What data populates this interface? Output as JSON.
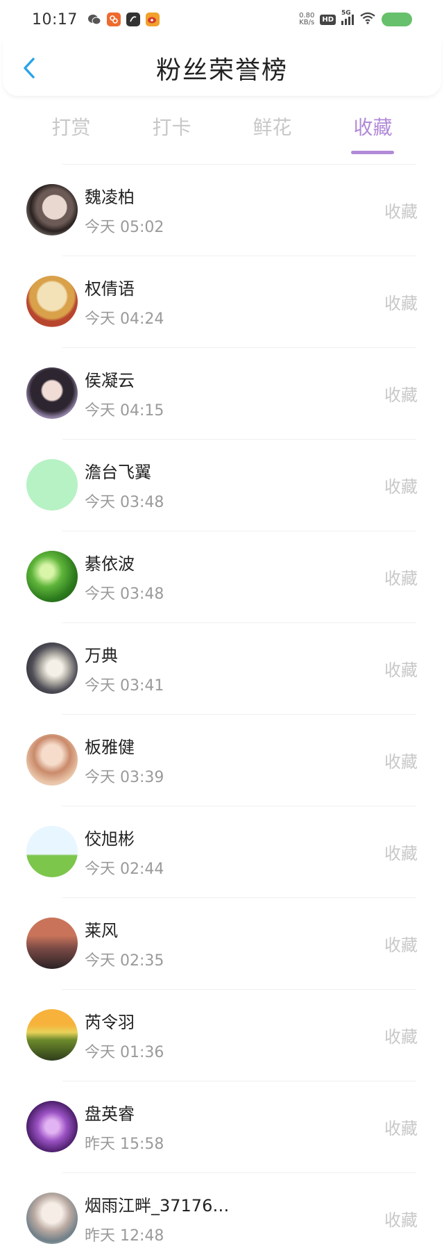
{
  "status_bar": {
    "time": "10:17",
    "net_speed_value": "0.80",
    "net_speed_unit": "KB/s",
    "hd_label": "HD",
    "network_label": "5G",
    "app_icons": [
      "wechat-icon",
      "app-icon-orange",
      "app-icon-dark",
      "weibo-icon"
    ]
  },
  "header": {
    "title": "粉丝荣誉榜",
    "back_icon": "chevron-left-icon"
  },
  "tabs": [
    {
      "label": "打赏",
      "active": false
    },
    {
      "label": "打卡",
      "active": false
    },
    {
      "label": "鲜花",
      "active": false
    },
    {
      "label": "收藏",
      "active": true
    }
  ],
  "colors": {
    "accent": "#b28ad7",
    "back_icon": "#2aa5e6",
    "battery": "#67c06b"
  },
  "fans": [
    {
      "name": "魏凌柏",
      "time": "今天 05:02",
      "action": "收藏"
    },
    {
      "name": "权倩语",
      "time": "今天 04:24",
      "action": "收藏"
    },
    {
      "name": "侯凝云",
      "time": "今天 04:15",
      "action": "收藏"
    },
    {
      "name": "澹台飞翼",
      "time": "今天 03:48",
      "action": "收藏"
    },
    {
      "name": "綦依波",
      "time": "今天 03:48",
      "action": "收藏"
    },
    {
      "name": "万典",
      "time": "今天 03:41",
      "action": "收藏"
    },
    {
      "name": "板雅健",
      "time": "今天 03:39",
      "action": "收藏"
    },
    {
      "name": "佼旭彬",
      "time": "今天 02:44",
      "action": "收藏"
    },
    {
      "name": "莱风",
      "time": "今天 02:35",
      "action": "收藏"
    },
    {
      "name": "芮令羽",
      "time": "今天 01:36",
      "action": "收藏"
    },
    {
      "name": "盘英睿",
      "time": "昨天 15:58",
      "action": "收藏"
    },
    {
      "name": "烟雨江畔_37176…",
      "time": "昨天 12:48",
      "action": "收藏"
    }
  ]
}
